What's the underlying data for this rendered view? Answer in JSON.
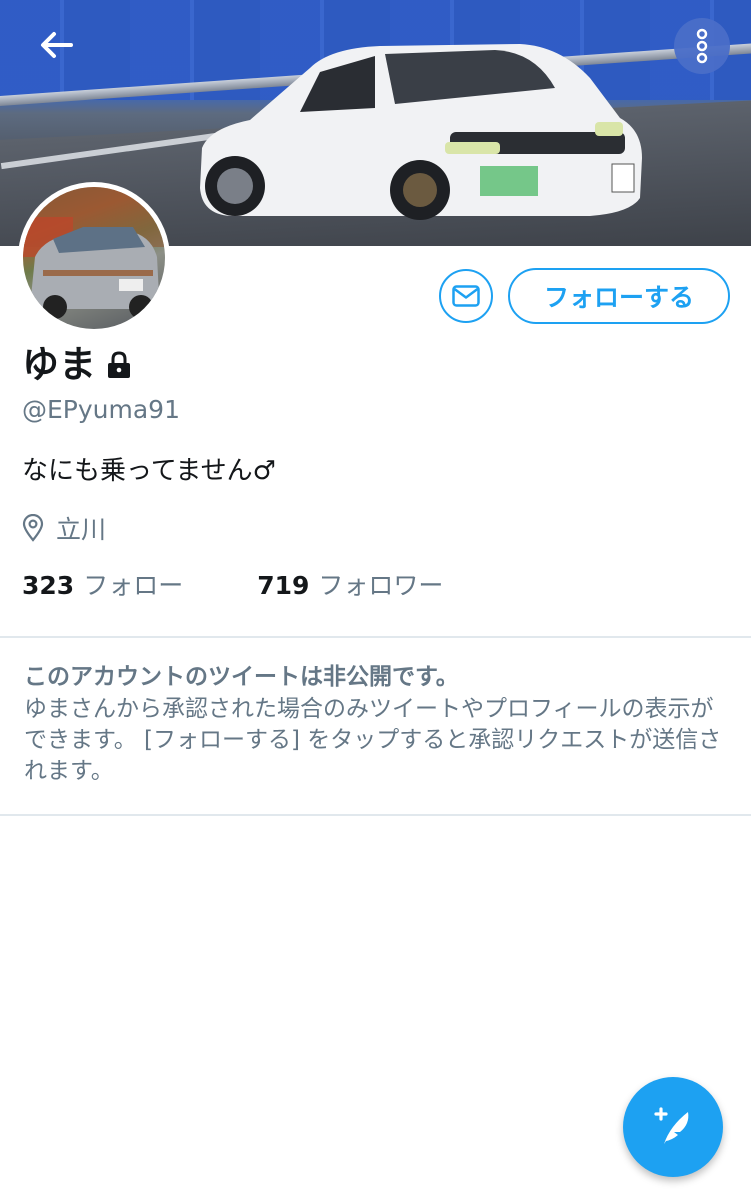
{
  "profile": {
    "name": "ゆま",
    "handle": "@EPyuma91",
    "bio": "なにも乗ってません♂",
    "location": "立川",
    "following_count": "323",
    "following_label": "フォロー",
    "followers_count": "719",
    "followers_label": "フォロワー"
  },
  "actions": {
    "follow_label": "フォローする"
  },
  "private_notice": {
    "title": "このアカウントのツイートは非公開です。",
    "body": "ゆまさんから承認された場合のみツイートやプロフィールの表示ができます。 [フォローする] をタップすると承認リクエストが送信されます。"
  },
  "icons": {
    "back": "arrow-left-icon",
    "more": "more-vertical-icon",
    "message": "envelope-icon",
    "lock": "lock-icon",
    "location": "location-pin-icon",
    "compose": "compose-feather-icon"
  },
  "colors": {
    "accent": "#1da1f2",
    "secondary_text": "#657786",
    "primary_text": "#14171a",
    "divider": "#e1e8ed"
  }
}
